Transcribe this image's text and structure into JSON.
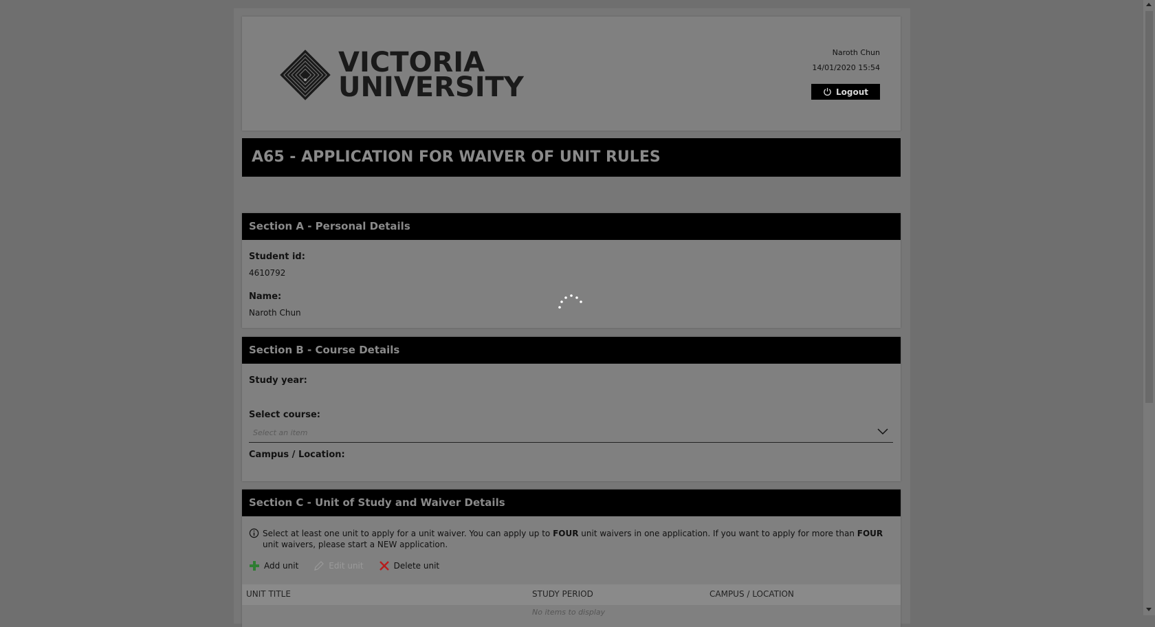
{
  "header": {
    "logo_line1": "VICTORIA",
    "logo_line2": "UNIVERSITY",
    "user_name": "Naroth Chun",
    "datetime": "14/01/2020 15:54",
    "logout_label": "Logout"
  },
  "page_title": "A65 - APPLICATION FOR WAIVER OF UNIT RULES",
  "sectionA": {
    "title": "Section A - Personal Details",
    "student_id_label": "Student id:",
    "student_id_value": "4610792",
    "name_label": "Name:",
    "name_value": "Naroth Chun"
  },
  "sectionB": {
    "title": "Section B - Course Details",
    "study_year_label": "Study year:",
    "select_course_label": "Select course:",
    "select_course_placeholder": "Select an item",
    "campus_label": "Campus / Location:"
  },
  "sectionC": {
    "title": "Section C - Unit of Study and Waiver Details",
    "info_part1": "Select at least one unit to apply for a unit waiver. You can apply up to ",
    "info_bold1": "FOUR",
    "info_part2": " unit waivers in one application. If you want to apply for more than ",
    "info_bold2": "FOUR",
    "info_part3": " unit waivers, please start a NEW application.",
    "add_unit": "Add unit",
    "edit_unit": "Edit unit",
    "delete_unit": "Delete unit",
    "columns": [
      "UNIT TITLE",
      "STUDY PERIOD",
      "CAMPUS / LOCATION"
    ],
    "empty_text": "No items to display"
  },
  "colors": {
    "add_icon": "#2e7d32",
    "delete_icon": "#b71c1c",
    "header_bar": "#000000"
  }
}
